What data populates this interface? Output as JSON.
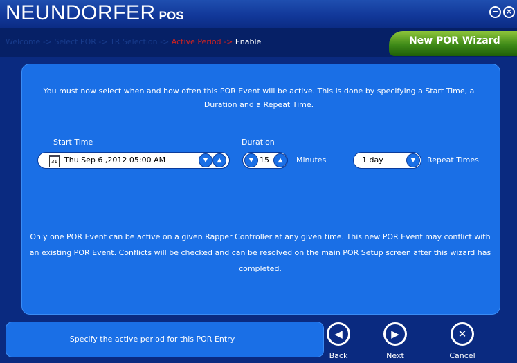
{
  "app": {
    "title_main": "NEUNDORFER",
    "title_pos": "POS"
  },
  "window": {
    "minimize_glyph": "−",
    "close_glyph": "×"
  },
  "breadcrumb": {
    "items": [
      "Welcome ->",
      "Select POR ->",
      "TR Selection ->",
      "Active Period ->",
      "Enable"
    ],
    "active_index": 3
  },
  "wizard": {
    "title": "New POR Wizard"
  },
  "panel": {
    "intro_text": "You must now select when and how often this POR Event will be active. This is done by specifying a Start Time, a Duration and a Repeat Time.",
    "start_time": {
      "label": "Start Time",
      "calendar_day": "31",
      "value": "Thu Sep  6 ,2012  05:00 AM"
    },
    "duration": {
      "label": "Duration",
      "value": "15",
      "unit": "Minutes"
    },
    "repeat": {
      "value": "1 day",
      "label": "Repeat Times"
    },
    "note_text": "Only one POR Event can be active on a given Rapper Controller at any given time. This new POR Event may conflict with an existing POR Event. Conflicts will be checked and can be resolved on the main POR Setup screen after this wizard has completed."
  },
  "footer": {
    "hint": "Specify the active period for this POR Entry",
    "buttons": {
      "back": "Back",
      "next": "Next",
      "cancel": "Cancel"
    }
  },
  "colors": {
    "background": "#0a2a80",
    "panel": "#1a6fe6",
    "header": "#12389a",
    "tab_green": "#3e8a18",
    "crumb_active": "#cc2222"
  }
}
